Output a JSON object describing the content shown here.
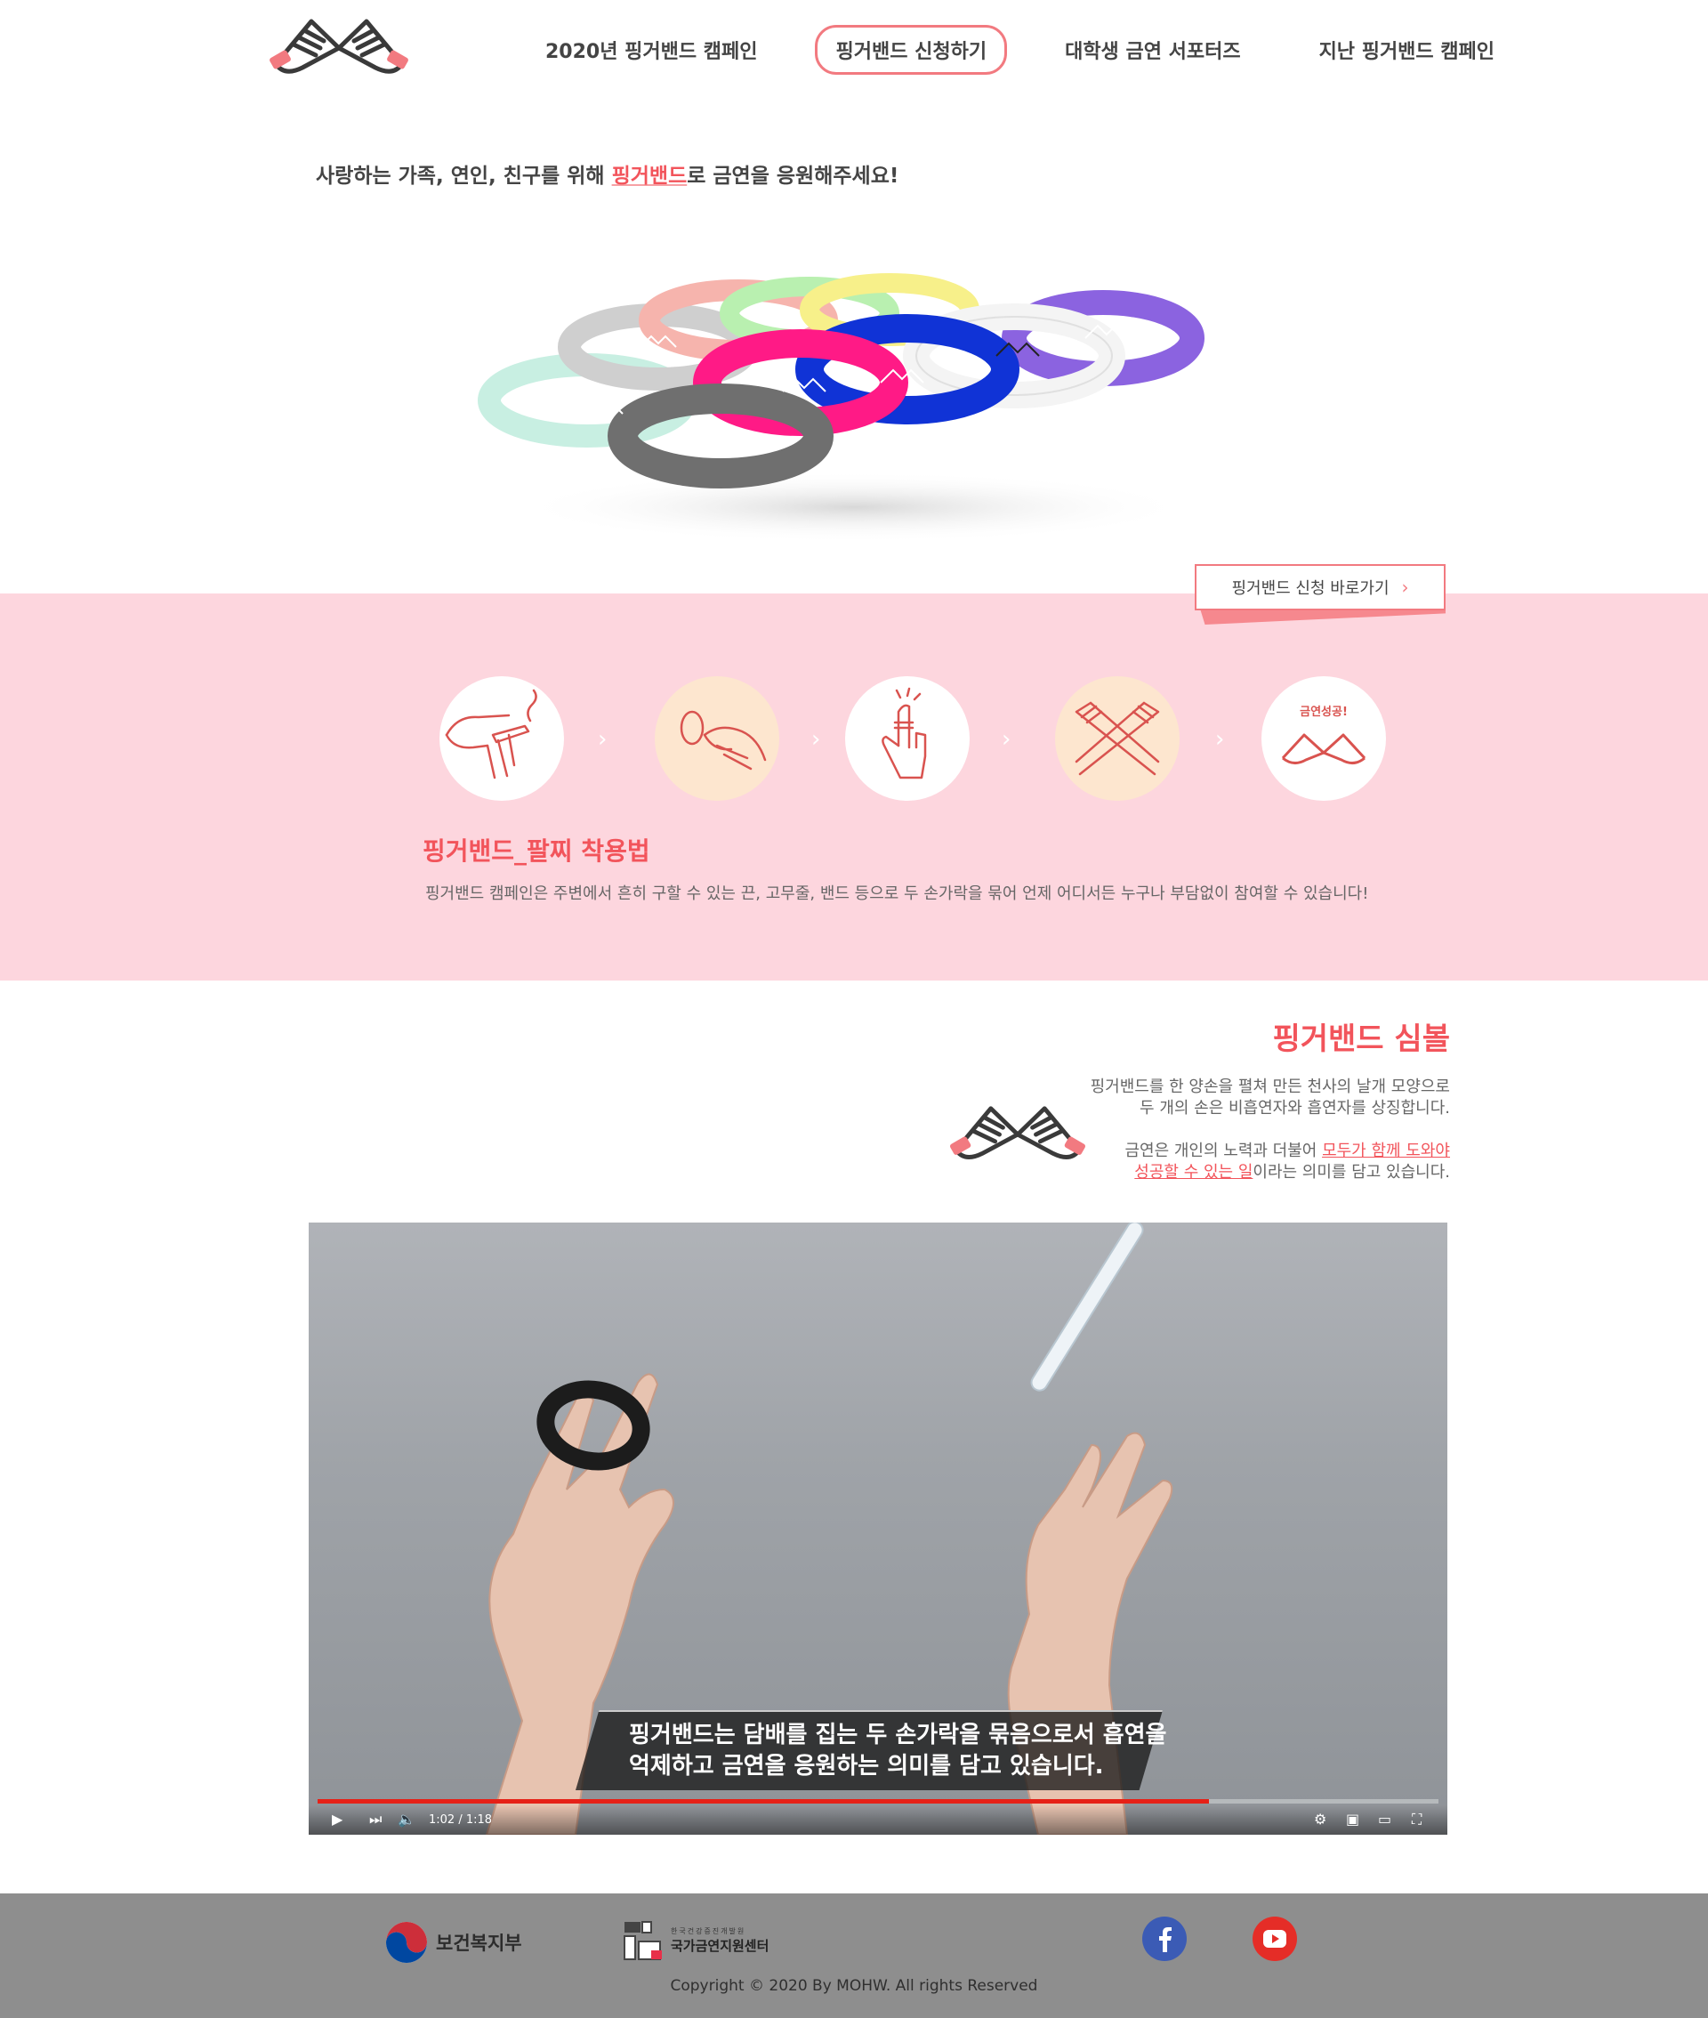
{
  "nav": {
    "items": [
      {
        "label": "2020년 핑거밴드 캠페인"
      },
      {
        "label": "핑거밴드 신청하기"
      },
      {
        "label": "대학생 금연 서포터즈"
      },
      {
        "label": "지난 핑거밴드 캠페인"
      }
    ]
  },
  "hero": {
    "tagline_before": "사랑하는 가족, 연인, 친구를 위해 ",
    "tagline_highlight": "핑거밴드",
    "tagline_after": "로 금연을 응원해주세요!"
  },
  "apply_button": {
    "label": "핑거밴드 신청 바로가기"
  },
  "howto": {
    "badge_text": "금연성공!",
    "title": "핑거밴드_팔찌 착용법",
    "description": "핑거밴드 캠페인은 주변에서 흔히 구할 수 있는 끈, 고무줄, 밴드 등으로 두 손가락을 묶어 언제 어디서든 누구나 부담없이 참여할 수 있습니다!"
  },
  "symbol": {
    "title": "핑거밴드 심볼",
    "line1": "핑거밴드를 한 양손을 펼쳐 만든 천사의 날개 모양으로",
    "line2": "두 개의 손은 비흡연자와 흡연자를 상징합니다.",
    "line3_before": "금연은 개인의 노력과 더불어 ",
    "line3_highlight": "모두가 함께 도와야",
    "line4_highlight": "성공할 수 있는 일",
    "line4_after": "이라는 의미를 담고 있습니다."
  },
  "video": {
    "caption_line1_strong": "핑거밴드",
    "caption_line1_rest": "는 담배를 집는 두 손가락을 묶음으로서 흡연을",
    "caption_line2": "억제하고 금연을 응원하는 의미를 담고 있습니다.",
    "time": "1:02 / 1:18",
    "progress": 0.795
  },
  "footer": {
    "ministry": "보건복지부",
    "center_small": "한국건강증진개발원",
    "center_name": "국가금연지원센터",
    "copyright": "Copyright © 2020 By MOHW. All rights Reserved"
  },
  "colors": {
    "accent": "#f2545b",
    "pink_bg": "#fdd6de",
    "peach": "#fde6cf",
    "footer_bg": "#8e8e8e"
  }
}
